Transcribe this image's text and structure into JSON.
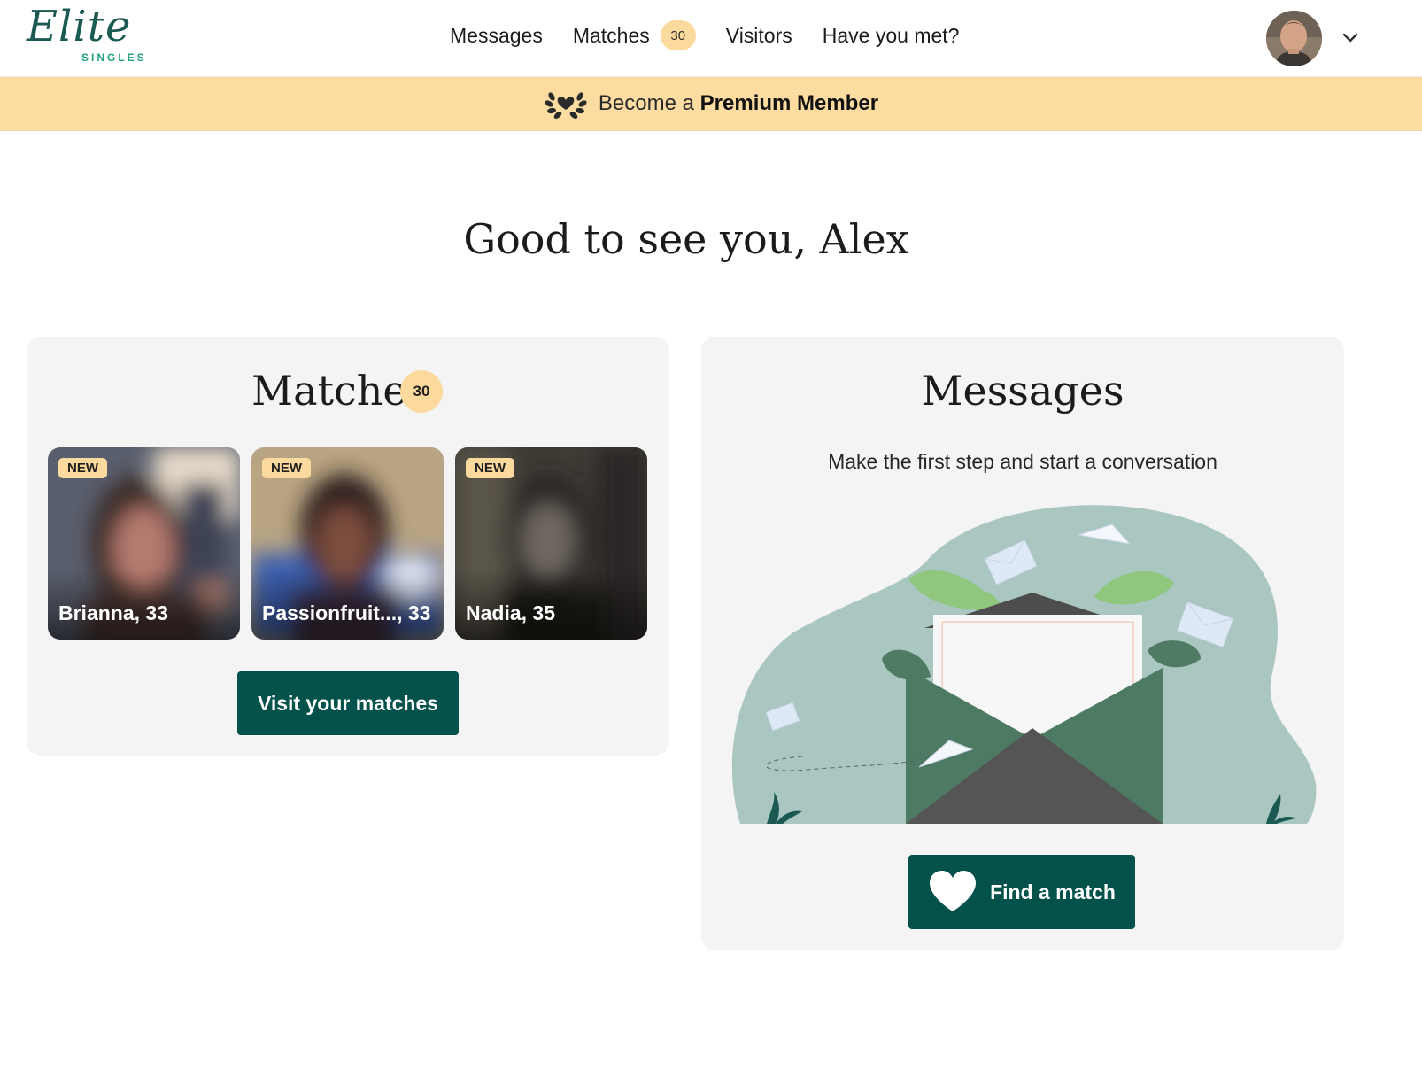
{
  "header": {
    "logo_word": "Elite",
    "logo_sub": "SINGLES",
    "nav": [
      {
        "label": "Messages"
      },
      {
        "label": "Matches",
        "badge": "30"
      },
      {
        "label": "Visitors"
      },
      {
        "label": "Have you met?"
      }
    ]
  },
  "banner": {
    "text_prefix": "Become a",
    "text_bold": "Premium Member"
  },
  "greeting": "Good to see you, Alex",
  "matches_card": {
    "title": "Matches",
    "badge": "30",
    "items": [
      {
        "badge": "NEW",
        "name": "Brianna, 33"
      },
      {
        "badge": "NEW",
        "name": "Passionfruit..., 33"
      },
      {
        "badge": "NEW",
        "name": "Nadia, 35"
      }
    ],
    "button": "Visit your matches"
  },
  "messages_card": {
    "title": "Messages",
    "subtitle": "Make the first step and start a conversation",
    "button": "Find a match"
  },
  "colors": {
    "brand_dark": "#03514b",
    "accent_peach": "#fcd99c",
    "banner_bg": "#fddca2",
    "card_bg": "#f4f4f4"
  },
  "icons": [
    "laurel-heart-icon",
    "chevron-down-icon",
    "heart-icon"
  ]
}
